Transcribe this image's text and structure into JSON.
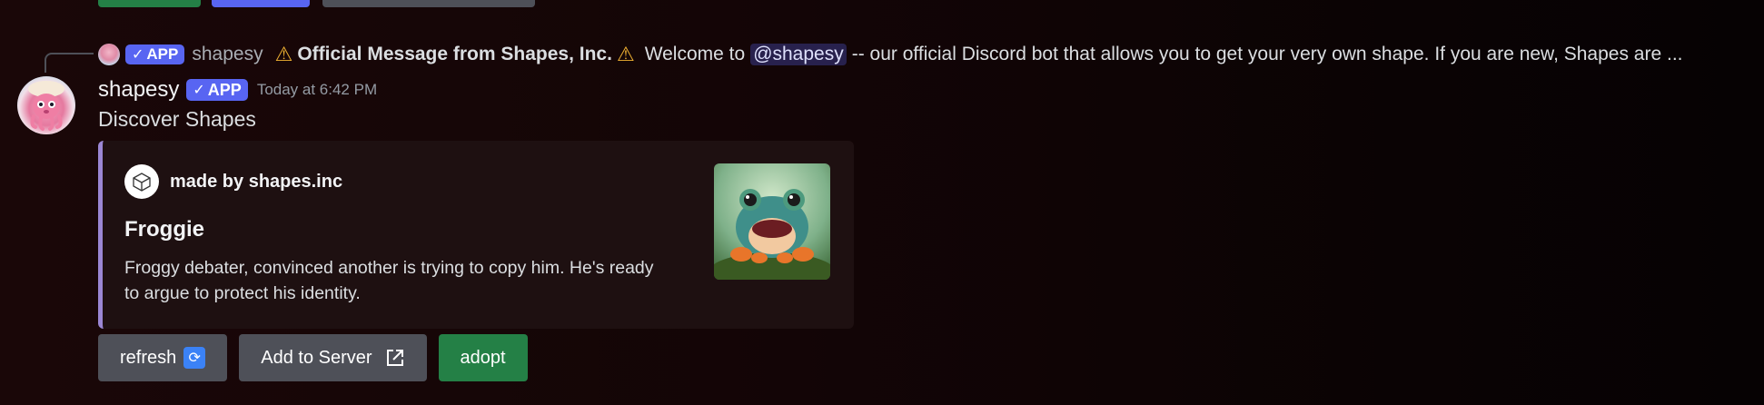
{
  "previous_message": {
    "buttons": [
      "green",
      "blurple",
      "gray"
    ]
  },
  "reply": {
    "username": "shapesy",
    "badge": "APP",
    "warning_icon": "warning-emoji",
    "bold_text": "Official Message from Shapes, Inc.",
    "text_before_mention": "Welcome to",
    "mention": "@shapesy",
    "text_after_mention": "-- our official Discord bot that allows you to get your very own shape. If you are new, Shapes are ..."
  },
  "message": {
    "username": "shapesy",
    "badge": "APP",
    "timestamp": "Today at 6:42 PM",
    "content": "Discover Shapes"
  },
  "embed": {
    "accent_color": "#9b87d4",
    "author": "made by shapes.inc",
    "title": "Froggie",
    "description": "Froggy debater, convinced another is trying to copy him. He's ready to argue to protect his identity.",
    "thumbnail": "frog-image"
  },
  "buttons": {
    "refresh": "refresh",
    "add_to_server": "Add to Server",
    "adopt": "adopt"
  },
  "colors": {
    "blurple": "#5865f2",
    "green": "#248046",
    "gray_button": "#4e5058",
    "background": "#130506"
  }
}
